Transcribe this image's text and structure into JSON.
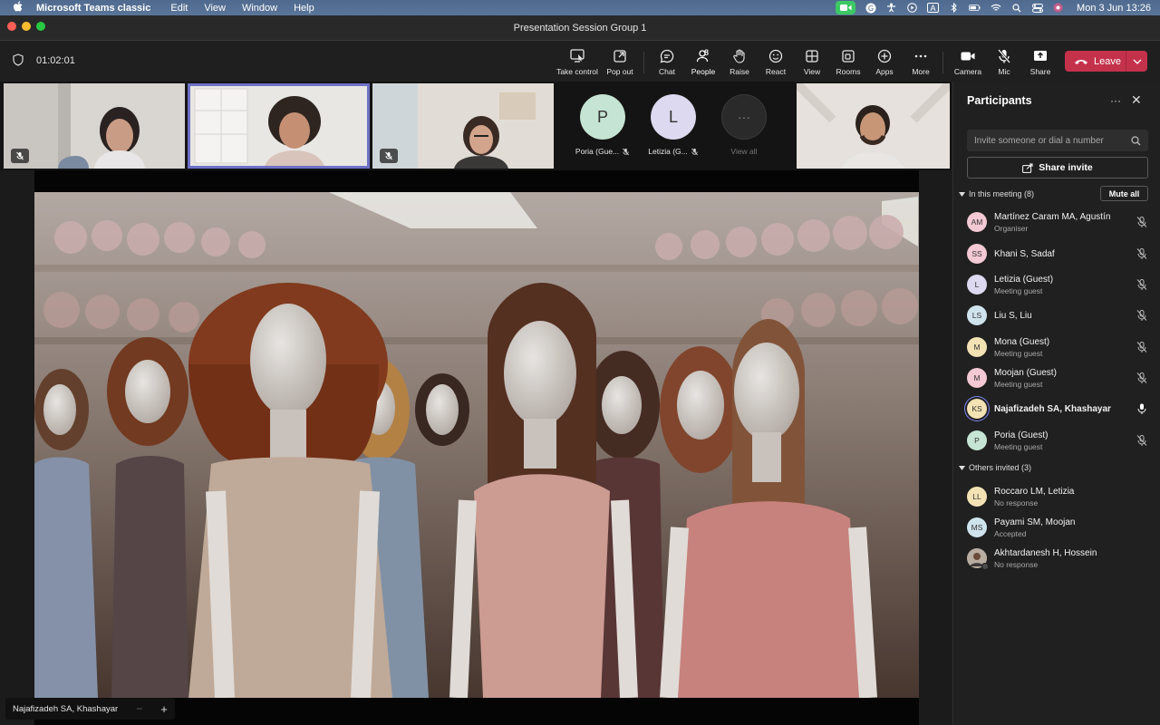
{
  "menubar": {
    "app_name": "Microsoft Teams classic",
    "menus": [
      "Edit",
      "View",
      "Window",
      "Help"
    ],
    "datetime": "Mon 3 Jun  13:26"
  },
  "window": {
    "title": "Presentation Session Group 1"
  },
  "toolbar": {
    "timer": "01:02:01",
    "take_control": "Take control",
    "pop_out": "Pop out",
    "chat": "Chat",
    "people": "People",
    "people_count": "8",
    "raise": "Raise",
    "react": "React",
    "view": "View",
    "rooms": "Rooms",
    "apps": "Apps",
    "more": "More",
    "camera": "Camera",
    "mic": "Mic",
    "share": "Share",
    "leave": "Leave"
  },
  "gallery": {
    "avatar_tiles": [
      {
        "initial": "P",
        "name": "Poria (Gue...",
        "color": "#c5e4d3"
      },
      {
        "initial": "L",
        "name": "Letizia (G...",
        "color": "#dcd9f0"
      }
    ],
    "view_all": "View all"
  },
  "stage": {
    "presenter": "Najafizadeh SA, Khashayar"
  },
  "panel": {
    "title": "Participants",
    "search_placeholder": "Invite someone or dial a number",
    "share_invite": "Share invite",
    "in_meeting_label": "In this meeting (8)",
    "mute_all": "Mute all",
    "others_label": "Others invited (3)",
    "in_meeting": [
      {
        "initials": "AM",
        "name": "Martínez Caram MA, Agustín",
        "sub": "Organiser",
        "color": "#f3c9d3"
      },
      {
        "initials": "SS",
        "name": "Khani S, Sadaf",
        "sub": "",
        "color": "#f3c9d3"
      },
      {
        "initials": "L",
        "name": "Letizia (Guest)",
        "sub": "Meeting guest",
        "color": "#dcd9f0"
      },
      {
        "initials": "LS",
        "name": "Liu S, Liu",
        "sub": "",
        "color": "#cfe3ec"
      },
      {
        "initials": "M",
        "name": "Mona (Guest)",
        "sub": "Meeting guest",
        "color": "#f3e3b4"
      },
      {
        "initials": "M",
        "name": "Moojan (Guest)",
        "sub": "Meeting guest",
        "color": "#f3c9d3"
      },
      {
        "initials": "KS",
        "name": "Najafizadeh SA, Khashayar",
        "sub": "",
        "color": "#f3e3b4"
      },
      {
        "initials": "P",
        "name": "Poria (Guest)",
        "sub": "Meeting guest",
        "color": "#c5e4d3"
      }
    ],
    "others": [
      {
        "initials": "LL",
        "name": "Roccaro LM, Letizia",
        "sub": "No response",
        "color": "#f3e3b4"
      },
      {
        "initials": "MS",
        "name": "Payami SM, Moojan",
        "sub": "Accepted",
        "color": "#cfe3ec"
      },
      {
        "initials": "",
        "name": "Akhtardanesh H, Hossein",
        "sub": "No response",
        "color": "#8a7a6a"
      }
    ]
  }
}
